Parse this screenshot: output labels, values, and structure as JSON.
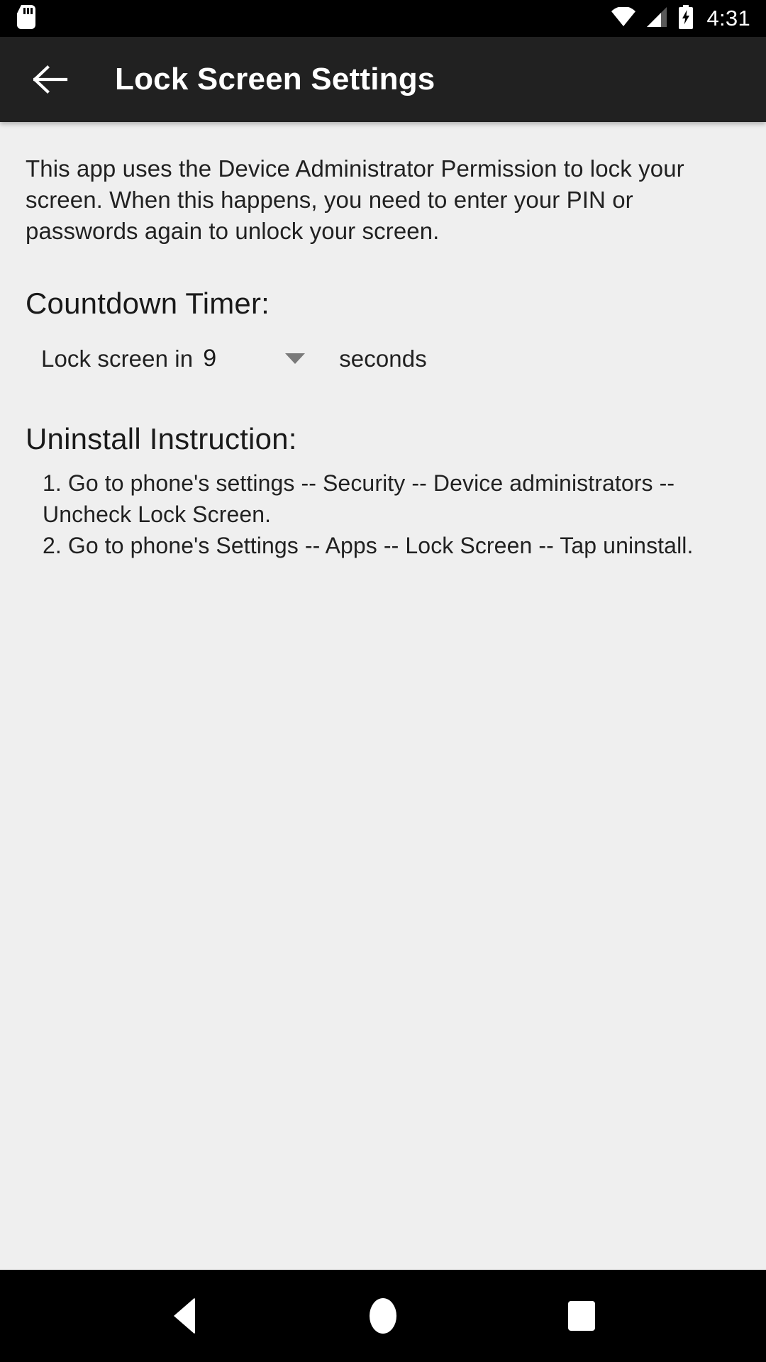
{
  "statusbar": {
    "sd_icon": "sd-card-icon",
    "wifi_icon": "wifi-icon",
    "signal_icon": "cellular-signal-icon",
    "battery_icon": "battery-charging-icon",
    "time": "4:31"
  },
  "appbar": {
    "back_icon": "back-arrow-icon",
    "title": "Lock Screen Settings"
  },
  "content": {
    "description": "This app uses the Device Administrator Permission to lock your screen. When this happens, you need to enter your PIN or passwords again to unlock your screen.",
    "countdown": {
      "heading": "Countdown Timer:",
      "prefix_label": "Lock screen in",
      "selected_value": "9",
      "dropdown_icon": "caret-down-icon",
      "unit_label": "seconds"
    },
    "uninstall": {
      "heading": "Uninstall Instruction:",
      "steps": [
        "1. Go to phone's settings -- Security -- Device administrators -- Uncheck Lock Screen.",
        "2. Go to phone's Settings -- Apps -- Lock Screen -- Tap uninstall."
      ]
    }
  },
  "navbar": {
    "back_label": "back-button",
    "home_label": "home-button",
    "recents_label": "recents-button"
  },
  "colors": {
    "statusbar_bg": "#000000",
    "appbar_bg": "#212121",
    "page_bg": "#efefef",
    "text_primary": "#212121",
    "caret": "#7a7a7a",
    "navbar_bg": "#000000"
  }
}
